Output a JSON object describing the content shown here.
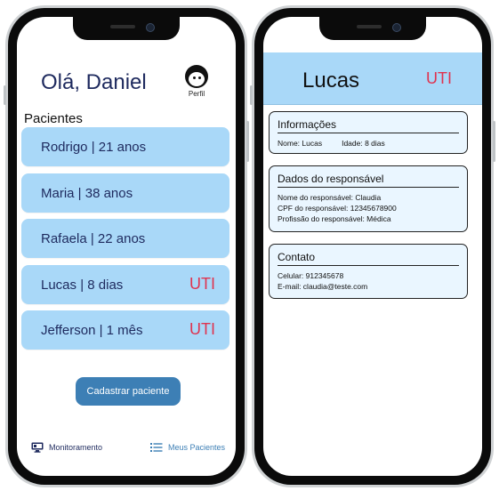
{
  "left_screen": {
    "greeting": "Olá, Daniel",
    "profile_label": "Perfil",
    "section_title": "Pacientes",
    "patients": [
      {
        "label": "Rodrigo |  21  anos",
        "badge": ""
      },
      {
        "label": "Maria |  38  anos",
        "badge": ""
      },
      {
        "label": "Rafaela |  22  anos",
        "badge": ""
      },
      {
        "label": "Lucas |  8  dias",
        "badge": "UTI"
      },
      {
        "label": "Jefferson |  1  mês",
        "badge": "UTI"
      }
    ],
    "register_button": "Cadastrar paciente",
    "nav": {
      "monitoring": "Monitoramento",
      "my_patients": "Meus Pacientes"
    }
  },
  "right_screen": {
    "name": "Lucas",
    "badge": "UTI",
    "info": {
      "title": "Informações",
      "name_line": "Nome: Lucas",
      "age_line": "Idade:  8  dias"
    },
    "guardian": {
      "title": "Dados do responsável",
      "name_line": "Nome do responsável:  Claudia",
      "cpf_line": "CPF do responsável:  12345678900",
      "profession_line": "Profissão do responsável:  Médica"
    },
    "contact": {
      "title": "Contato",
      "phone_line": "Celular:  912345678",
      "email_line": "E-mail:  claudia@teste.com"
    }
  },
  "colors": {
    "card_blue": "#a9d8f8",
    "primary_text": "#1e2a5e",
    "alert_red": "#e0334f",
    "button_blue": "#3d7fb5"
  }
}
